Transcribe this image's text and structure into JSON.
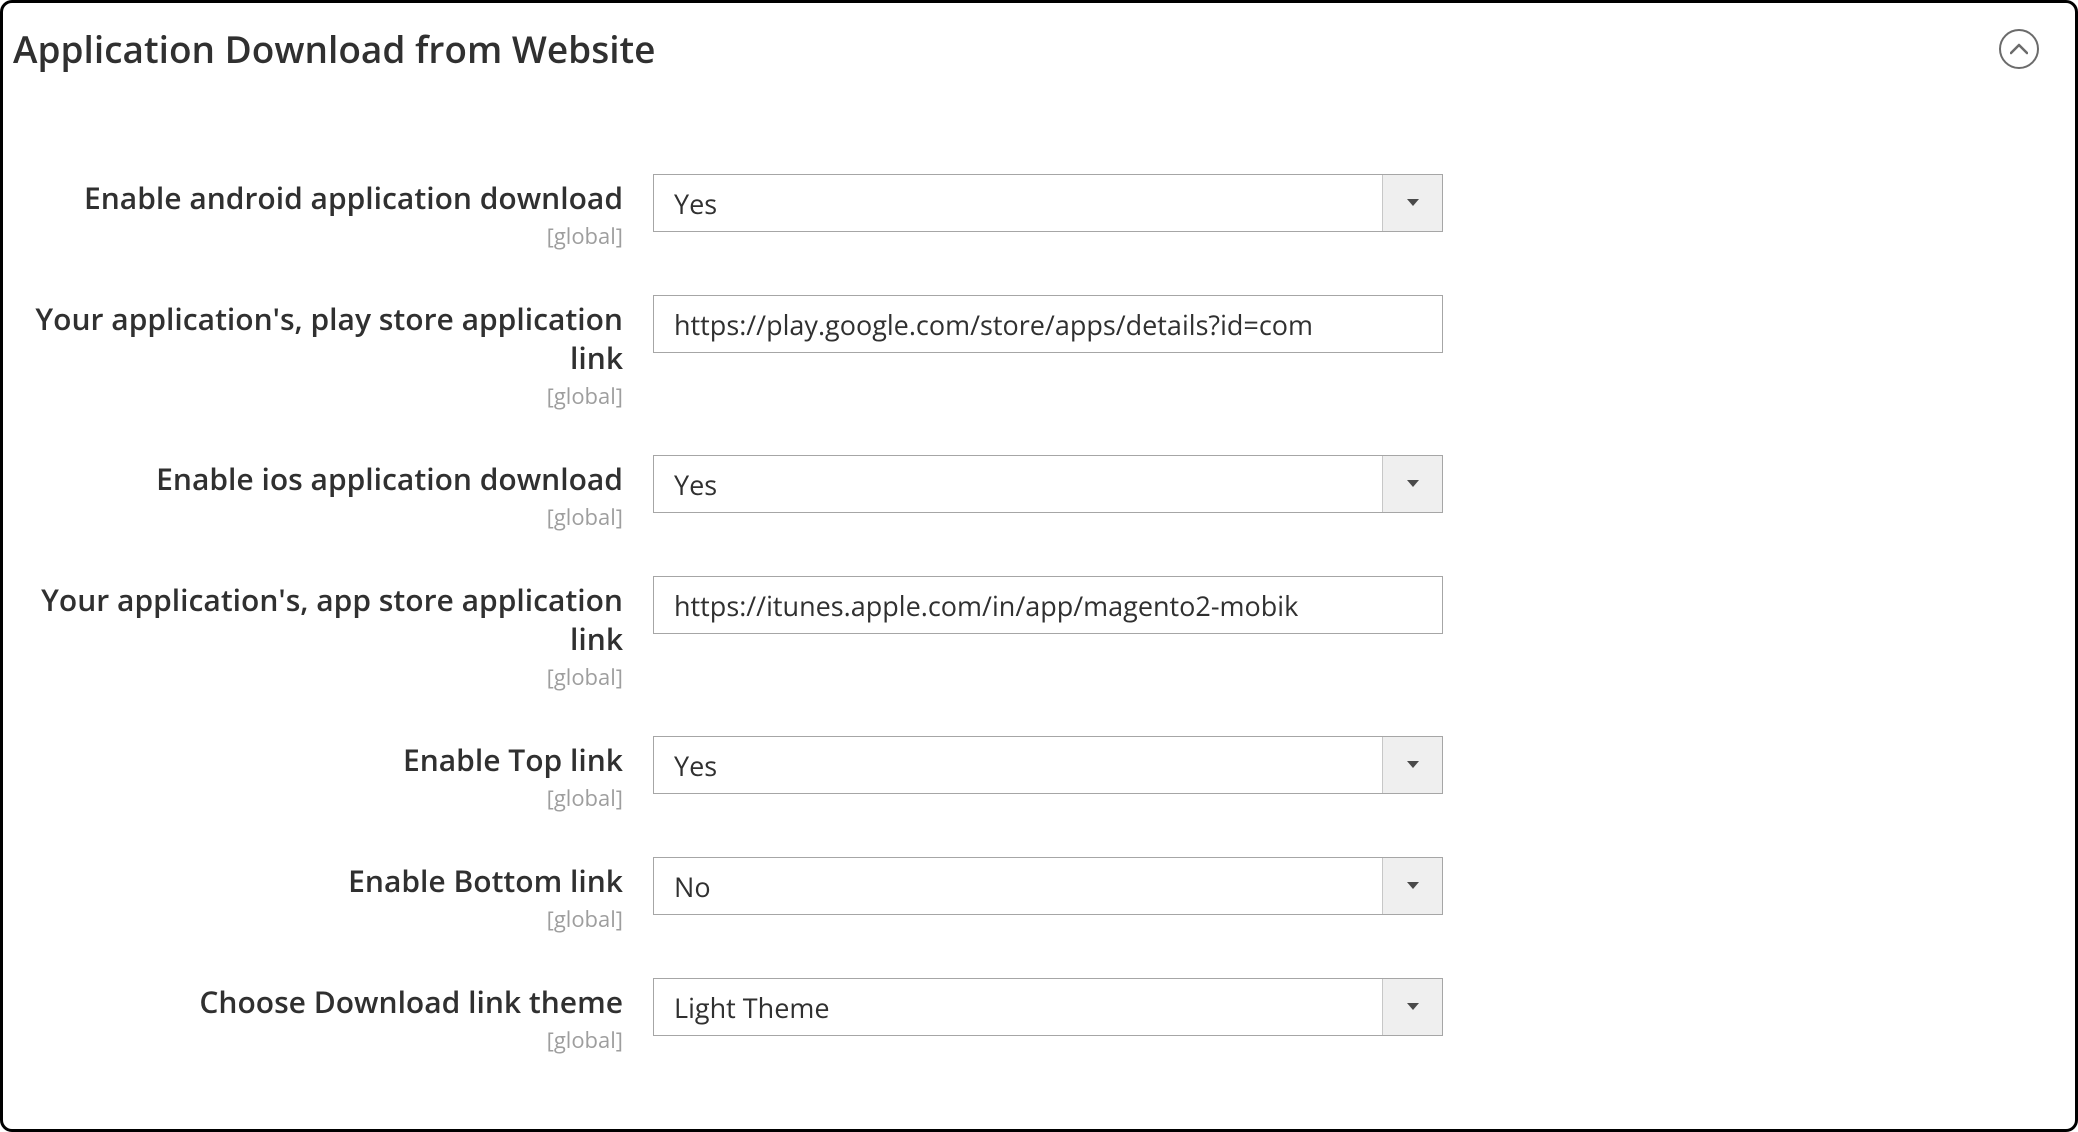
{
  "section": {
    "title": "Application Download from Website"
  },
  "scope": "[global]",
  "fields": {
    "enable_android": {
      "label": "Enable android application download",
      "value": "Yes"
    },
    "play_store_link": {
      "label": "Your application's, play store application link",
      "value": "https://play.google.com/store/apps/details?id=com"
    },
    "enable_ios": {
      "label": "Enable ios application download",
      "value": "Yes"
    },
    "app_store_link": {
      "label": "Your application's, app store application link",
      "value": "https://itunes.apple.com/in/app/magento2-mobik"
    },
    "enable_top_link": {
      "label": "Enable Top link",
      "value": "Yes"
    },
    "enable_bottom_link": {
      "label": "Enable Bottom link",
      "value": "No"
    },
    "download_link_theme": {
      "label": "Choose Download link theme",
      "value": "Light Theme"
    }
  }
}
